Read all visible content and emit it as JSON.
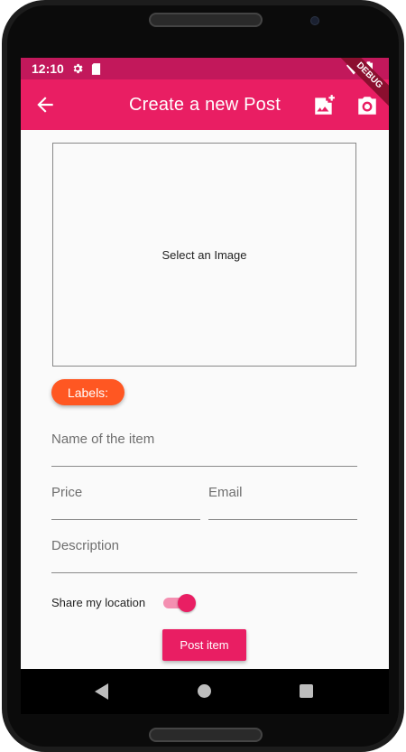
{
  "status_bar": {
    "time": "12:10",
    "debug_banner": "DEBUG"
  },
  "app_bar": {
    "title": "Create a new Post",
    "back_icon": "arrow-back-icon",
    "gallery_icon": "add-photo-icon",
    "camera_icon": "camera-icon"
  },
  "image_picker": {
    "label": "Select an Image"
  },
  "labels_chip": {
    "label": "Labels:"
  },
  "form": {
    "name_placeholder": "Name of the item",
    "price_placeholder": "Price",
    "email_placeholder": "Email",
    "description_placeholder": "Description"
  },
  "location": {
    "label": "Share my location",
    "enabled": true
  },
  "post_button": {
    "label": "Post item"
  },
  "colors": {
    "primary": "#e91e63",
    "primary_dark": "#c2185b",
    "accent": "#ff5722",
    "switch_track": "#f48fb1"
  }
}
